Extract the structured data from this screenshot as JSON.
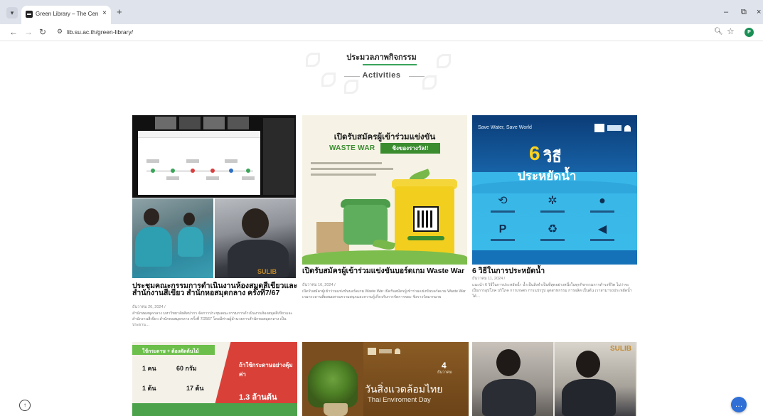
{
  "browser": {
    "tab_title": "Green Library – The Central Lib",
    "tab_close": "×",
    "new_tab": "+",
    "url": "lib.su.ac.th/green-library/",
    "profile_initial": "P",
    "min_btn": "–",
    "restore_btn": "⧉",
    "close_btn": "×"
  },
  "section": {
    "title_th": "ประมวลภาพกิจกรรม",
    "title_en": "Activities"
  },
  "cards": [
    {
      "title": "ประชุมคณะกรรมการดำเนินงานห้องสมุดสีเขียวและสำนักงานสีเขียว สำนักหอสมุดกลาง ครั้งที่7/67",
      "date": "ธันวาคม 26, 2024 /",
      "excerpt": "สำนักหอสมุดกลาง มหาวิทยาลัยศิลปากร จัดการประชุมคณะกรรมการดำเนินงานห้องสมุดสีเขียวและสำนักงานสีเขียว สำนักหอสมุดกลาง ครั้งที่ 7/2567 โดยมีท่านผู้อำนวยการสำนักหอสมุดกลาง เป็นประธาน…",
      "badge": "SULIB"
    },
    {
      "title": "เปิดรับสมัครผู้เข้าร่วมแข่งขันบอร์ดเกม Waste War",
      "date": "ธันวาคม 16, 2024 /",
      "excerpt": "เปิดรับสมัครผู้เข้าร่วมแข่งขันบอร์ดเกม Waste War เปิดรับสมัครผู้เข้าร่วมแข่งขันบอร์ดเกม Waste War เกมกระดานที่ผสมผสานความสนุกและความรู้เกี่ยวกับการจัดการขยะ ชิงรางวัลมากมาย",
      "img_title": "เปิดรับสมัครผู้เข้าร่วมแข่งขัน",
      "img_game": "WASTE WAR",
      "img_prize": "ชิงของรางวัล!!"
    },
    {
      "title": "6 วิธีในการประหยัดน้ำ",
      "date": "ธันวาคม 11, 2024 /",
      "excerpt": "แนะนำ 6 วิธีในการประหยัดน้ำ น้ำเป็นสิ่งจำเป็นที่สุดอย่างหนึ่งในทุกกิจกรรมการดำรงชีวิต ไม่ว่าจะเป็นการอุปโภค บริโภค การเกษตร การแปรรูป อุตสาหกรรม การผลิต เป็นต้น เราสามารถประหยัดน้ำได้…",
      "img_top": "Save Water, Save World",
      "img_six": "6",
      "img_six_word": "วิธี",
      "img_save": "ประหยัดน้ำ"
    }
  ],
  "row2": {
    "c4_line1": "ใช้กระดาษ + ต้องตัดต้นไม้",
    "c4_person": "1 คน",
    "c4_weight": "60 กรัม",
    "c4_tree": "1 ต้น",
    "c4_count": "17 ต้น",
    "c4_q": "ถ้าใช้กระดาษอย่างคุ้มค่า",
    "c4_big": "1.3 ล้านต้น",
    "c5_day": "4",
    "c5_month": "ธันวาคม",
    "c5_th": "วันสิ่งแวดล้อมไทย",
    "c5_en": "Thai Enviroment Day",
    "c6_badge": "SULIB"
  }
}
